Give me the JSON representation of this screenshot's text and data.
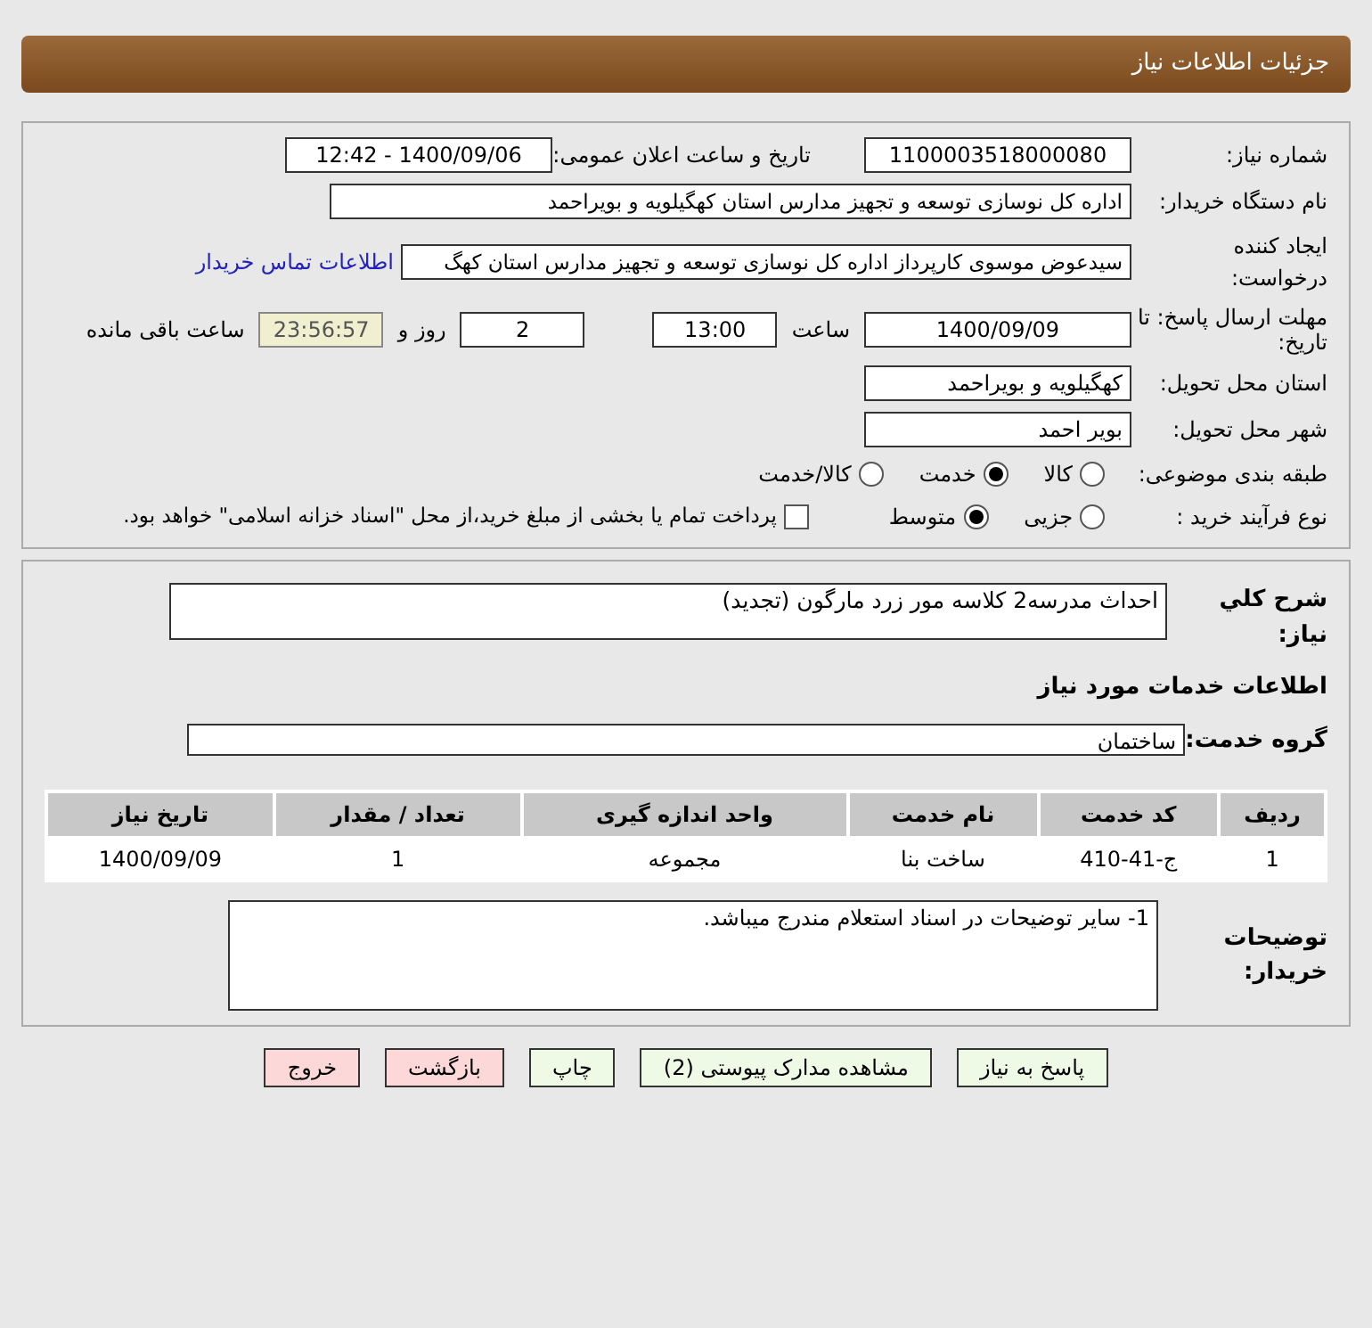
{
  "header": {
    "title": "جزئیات اطلاعات نیاز"
  },
  "details": {
    "need_number": {
      "label": "شماره نیاز:",
      "value": "1100003518000080"
    },
    "announce": {
      "label": "تاریخ و ساعت اعلان عمومی:",
      "value": "1400/09/06 - 12:42"
    },
    "buyer": {
      "label": "نام دستگاه خریدار:",
      "value": "اداره کل نوسازی  توسعه و تجهیز مدارس استان کهگیلویه و بویراحمد"
    },
    "creator": {
      "label": "ایجاد کننده درخواست:",
      "value": "سیدعوض موسوی کارپرداز اداره کل نوسازی  توسعه و تجهیز مدارس استان کهگ",
      "link": "اطلاعات تماس خریدار"
    },
    "deadline": {
      "label": "مهلت ارسال پاسخ: تا تاریخ:",
      "date": "1400/09/09",
      "time_label": "ساعت",
      "time": "13:00",
      "days": "2",
      "days_label": "روز و",
      "remaining": "23:56:57",
      "remaining_label": "ساعت باقی مانده"
    },
    "province": {
      "label": "استان محل تحویل:",
      "value": "کهگیلویه و بویراحمد"
    },
    "city": {
      "label": "شهر محل تحویل:",
      "value": "بویر احمد"
    },
    "category": {
      "label": "طبقه بندی موضوعی:",
      "options": [
        {
          "label": "کالا",
          "selected": false
        },
        {
          "label": "خدمت",
          "selected": true
        },
        {
          "label": "کالا/خدمت",
          "selected": false
        }
      ]
    },
    "process": {
      "label": "نوع فرآیند خرید :",
      "options": [
        {
          "label": "جزیی",
          "selected": false
        },
        {
          "label": "متوسط",
          "selected": true
        }
      ],
      "payment": {
        "label": "پرداخت تمام یا بخشی از مبلغ خرید،از محل \"اسناد خزانه اسلامی\" خواهد بود.",
        "checked": false
      }
    }
  },
  "summary": {
    "label": "شرح کلي نیاز:",
    "value": "احداث مدرسه2 کلاسه مور زرد مارگون (تجدید)"
  },
  "services_title": "اطلاعات خدمات مورد نیاز",
  "service_group": {
    "label": "گروه خدمت:",
    "value": "ساختمان"
  },
  "table": {
    "columns": [
      "ردیف",
      "کد خدمت",
      "نام خدمت",
      "واحد اندازه گیری",
      "تعداد / مقدار",
      "تاریخ نیاز"
    ],
    "rows": [
      [
        "1",
        "ج-41-410",
        "ساخت بنا",
        "مجموعه",
        "1",
        "1400/09/09"
      ]
    ]
  },
  "notes": {
    "label": "توضیحات خریدار:",
    "value": "1- سایر توضیحات در اسناد استعلام مندرج میباشد."
  },
  "buttons": [
    {
      "label": "پاسخ به نیاز",
      "kind": "normal"
    },
    {
      "label": "مشاهده مدارک پیوستی (2)",
      "kind": "normal"
    },
    {
      "label": "چاپ",
      "kind": "normal"
    },
    {
      "label": "بازگشت",
      "kind": "exit"
    },
    {
      "label": "خروج",
      "kind": "exit"
    }
  ]
}
